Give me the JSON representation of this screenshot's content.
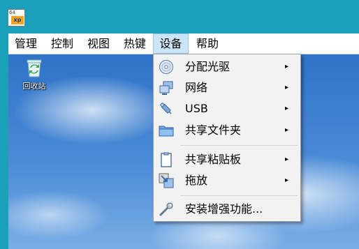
{
  "window": {
    "app_icon_text": "64",
    "app_icon_badge": "xp"
  },
  "menubar": {
    "items": [
      {
        "label": "管理"
      },
      {
        "label": "控制"
      },
      {
        "label": "视图"
      },
      {
        "label": "热键"
      },
      {
        "label": "设备"
      },
      {
        "label": "帮助"
      }
    ],
    "active": "设备"
  },
  "desktop": {
    "recycle_bin_label": "回收站"
  },
  "dropdown": {
    "items": [
      {
        "label": "分配光驱",
        "icon": "optical-disc-icon",
        "submenu": "▸"
      },
      {
        "label": "网络",
        "icon": "network-icon",
        "submenu": "▸"
      },
      {
        "label": "USB",
        "icon": "usb-icon",
        "submenu": "▸"
      },
      {
        "label": "共享文件夹",
        "icon": "shared-folder-icon",
        "submenu": "▸"
      },
      {
        "label": "共享粘贴板",
        "icon": "clipboard-icon",
        "submenu": "▸"
      },
      {
        "label": "拖放",
        "icon": "drag-drop-icon",
        "submenu": "▸"
      },
      {
        "label": "安装增强功能...",
        "icon": "wrench-icon"
      }
    ]
  }
}
